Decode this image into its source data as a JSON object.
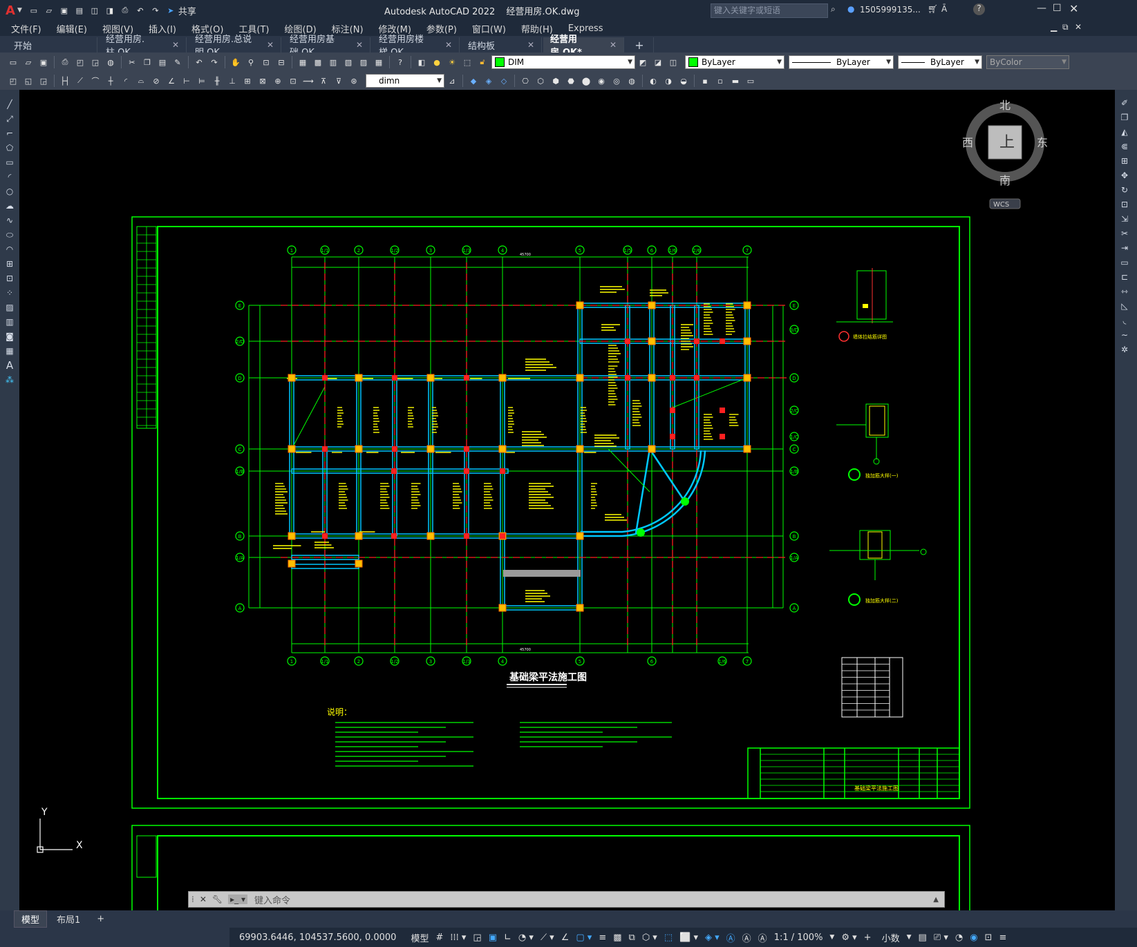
{
  "window": {
    "app_title": "Autodesk AutoCAD 2022",
    "file_title": "经营用房.OK.dwg",
    "share_label": "共享",
    "search_placeholder": "键入关键字或短语",
    "user": "1505999135...",
    "logo": "A"
  },
  "menus": [
    "文件(F)",
    "编辑(E)",
    "视图(V)",
    "插入(I)",
    "格式(O)",
    "工具(T)",
    "绘图(D)",
    "标注(N)",
    "修改(M)",
    "参数(P)",
    "窗口(W)",
    "帮助(H)",
    "Express"
  ],
  "tabs": [
    {
      "label": "开始",
      "closable": false
    },
    {
      "label": "经营用房.柱.OK",
      "closable": true
    },
    {
      "label": "经营用房.总说明.OK",
      "closable": true
    },
    {
      "label": "经营用房基础.OK",
      "closable": true
    },
    {
      "label": "经营用房楼梯.OK",
      "closable": true
    },
    {
      "label": "结构板",
      "closable": true
    },
    {
      "label": "经营用房.OK*",
      "closable": true,
      "active": true
    }
  ],
  "toolbar": {
    "layer_name": "DIM",
    "color": "ByLayer",
    "linetype": "ByLayer",
    "lineweight": "ByLayer",
    "plotstyle": "ByColor",
    "dimstyle": "dimn"
  },
  "viewcube": {
    "north": "北",
    "south": "南",
    "east": "东",
    "west": "西",
    "top": "上",
    "wcs": "WCS"
  },
  "ucs": {
    "x": "X",
    "y": "Y"
  },
  "drawing": {
    "title": "基础梁平法施工图",
    "notes_title": "说明：",
    "detail1": "墙体拉结筋详图",
    "detail2": "独加筋大样(一)",
    "detail3": "独加筋大样(二)",
    "axes_top": [
      "1",
      "1/1",
      "2",
      "1/2",
      "3",
      "1/3",
      "4",
      "5",
      "1/5",
      "6",
      "1/6",
      "2/6",
      "7"
    ],
    "axes_bottom": [
      "1",
      "1/1",
      "2",
      "1/2",
      "3",
      "1/3",
      "4",
      "5",
      "6",
      "1/6",
      "7"
    ],
    "axes_left": [
      "E",
      "2/D",
      "D",
      "C",
      "1/B",
      "B",
      "1/A",
      "A"
    ],
    "axes_right": [
      "E",
      "3/D",
      "D",
      "2/C",
      "1/C",
      "C",
      "1/B",
      "B",
      "1/A",
      "A"
    ],
    "total_dim": "45700",
    "title_block_name": "基础梁平法施工图"
  },
  "cmdline": {
    "placeholder": "键入命令"
  },
  "layout_tabs": [
    "模型",
    "布局1"
  ],
  "status": {
    "coords": "69903.6446, 104537.5600, 0.0000",
    "space": "模型",
    "scale": "1:1 / 100%",
    "units": "小数"
  },
  "colors": {
    "accent_green": "#00ff00",
    "red": "#ff2020",
    "yellow": "#ffff00",
    "cyan": "#00c8ff"
  }
}
